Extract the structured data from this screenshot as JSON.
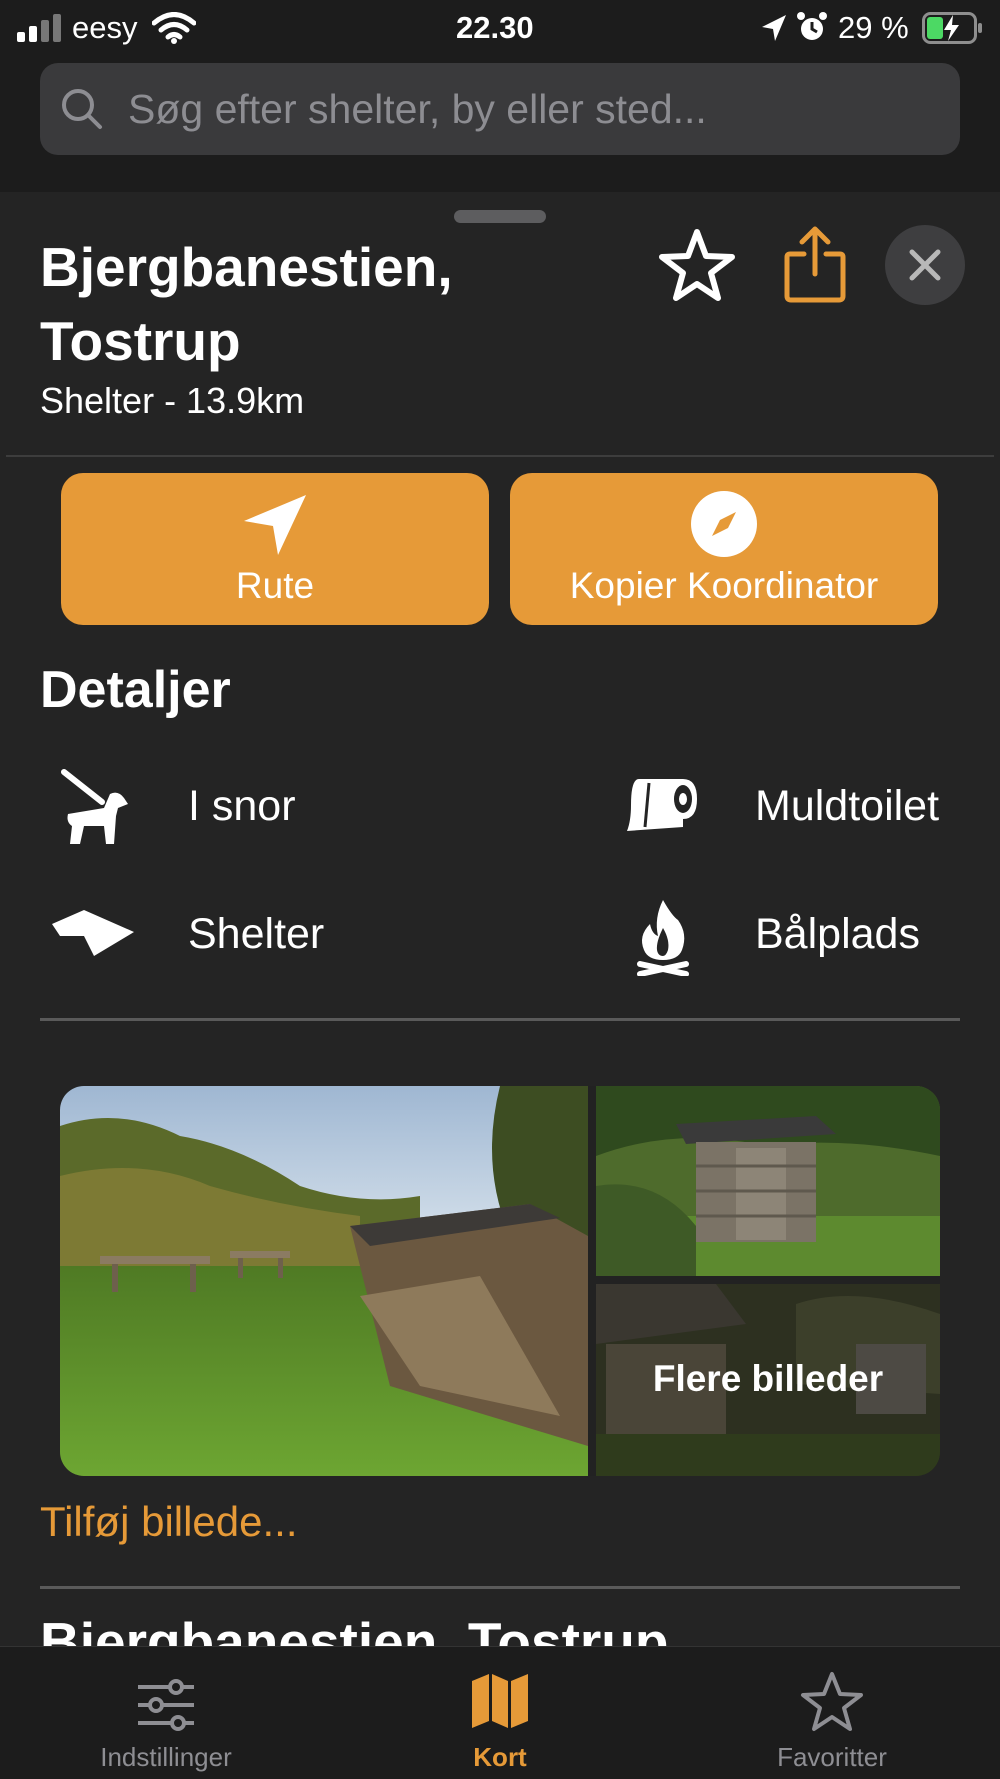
{
  "status_bar": {
    "carrier": "eesy",
    "time": "22.30",
    "battery": "29 %"
  },
  "search": {
    "placeholder": "Søg efter shelter, by eller sted..."
  },
  "place": {
    "title_line1": "Bjergbanestien,",
    "title_line2": "Tostrup",
    "subtitle": "Shelter - 13.9km"
  },
  "actions": {
    "route_label": "Rute",
    "copy_coords_label": "Kopier Koordinator"
  },
  "details": {
    "heading": "Detaljer",
    "items": [
      {
        "label": "I snor",
        "icon": "dog-leash-icon"
      },
      {
        "label": "Muldtoilet",
        "icon": "toilet-paper-icon"
      },
      {
        "label": "Shelter",
        "icon": "shelter-roof-icon"
      },
      {
        "label": "Bålplads",
        "icon": "campfire-icon"
      }
    ]
  },
  "gallery": {
    "more_label": "Flere billeder"
  },
  "add_photo_label": "Tilføj billede...",
  "peek_title": "Bjergbanestien, Tostrup",
  "tabbar": {
    "tabs": [
      {
        "label": "Indstillinger",
        "icon": "sliders-icon",
        "active": false
      },
      {
        "label": "Kort",
        "icon": "map-icon",
        "active": true
      },
      {
        "label": "Favoritter",
        "icon": "star-icon",
        "active": false
      }
    ]
  },
  "colors": {
    "accent": "#e69a38",
    "background": "#242424",
    "battery_charge": "#4cd964"
  }
}
